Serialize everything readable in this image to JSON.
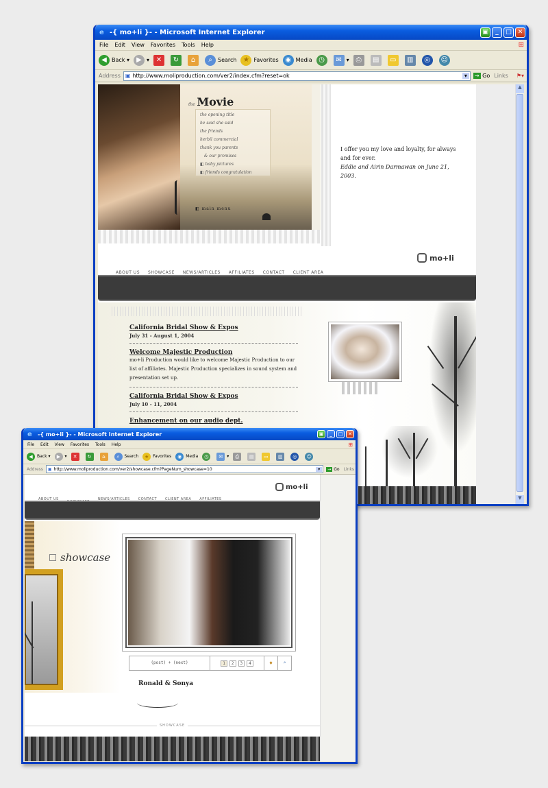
{
  "window1": {
    "title": "-{ mo+li }- - Microsoft Internet Explorer",
    "menu": [
      "File",
      "Edit",
      "View",
      "Favorites",
      "Tools",
      "Help"
    ],
    "toolbar": {
      "back": "Back",
      "search": "Search",
      "favorites": "Favorites",
      "media": "Media"
    },
    "address": {
      "label": "Address",
      "url": "http://www.moliproduction.com/ver2/index.cfm?reset=ok",
      "go": "Go",
      "links": "Links"
    },
    "movie": {
      "heading_small": "the",
      "heading": "Movie",
      "items": [
        "the opening title",
        "he said she said",
        "the friends",
        "herbil commercial",
        "thank you parents",
        "& our promises",
        "baby pictures",
        "friends congratulation"
      ],
      "main_menu": "main menu"
    },
    "quote": {
      "line1": "I offer you my love and loyalty, for always and for ever.",
      "line2": "Eddie and Airin Darmawan on June 21, 2003."
    },
    "logo": "mo+li",
    "nav": [
      "ABOUT US",
      "SHOWCASE",
      "NEWS/ARTICLES",
      "AFFILIATES",
      "CONTACT",
      "CLIENT AREA"
    ],
    "news": [
      {
        "title": "California Bridal Show & Expos",
        "date": "July 31 - August 1, 2004"
      },
      {
        "title": "Welcome Majestic Production",
        "body": "mo+li Production would like to welcome Majestic Production to our list of affiliates. Majestic Production specializes in sound system and presentation set up."
      },
      {
        "title": "California Bridal Show & Expos",
        "date": "July 10 - 11, 2004"
      },
      {
        "title": "Enhancement on our audio dept."
      }
    ]
  },
  "window2": {
    "title": "-{ mo+li }- - Microsoft Internet Explorer",
    "menu": [
      "File",
      "Edit",
      "View",
      "Favorites",
      "Tools",
      "Help"
    ],
    "toolbar": {
      "back": "Back",
      "search": "Search",
      "favorites": "Favorites",
      "media": "Media"
    },
    "address": {
      "label": "Address",
      "url": "http://www.moliproduction.com/ver2/showcase.cfm?PageNum_showcase=10",
      "go": "Go",
      "links": "Links"
    },
    "logo": "mo+li",
    "nav": [
      "ABOUT US",
      "SHOWCASE",
      "NEWS/ARTICLES",
      "CONTACT",
      "CLIENT AREA",
      "AFFILIATES"
    ],
    "showcase_label": "showcase",
    "pager": {
      "label": "(post) + (next)",
      "pages": [
        "1",
        "2",
        "3",
        "4"
      ]
    },
    "couple": "Ronald & Sonya",
    "footer_label": "SHOWCASE"
  },
  "colors": {
    "xp_blue": "#0a5de0",
    "nav_dark": "#3b3b3b",
    "page_bg": "#ececec"
  }
}
